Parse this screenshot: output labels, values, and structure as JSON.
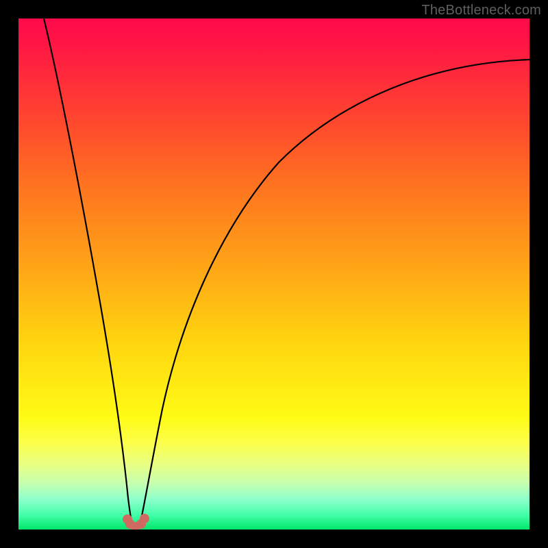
{
  "watermark": "TheBottleneck.com",
  "colors": {
    "frame": "#000000",
    "curve": "#000000",
    "marker_fill": "#cf6a61",
    "marker_stroke": "#cf6a61",
    "gradient_top": "#ff0a4b",
    "gradient_bottom": "#00e76a"
  },
  "chart_data": {
    "type": "line",
    "title": "",
    "xlabel": "",
    "ylabel": "",
    "xlim": [
      0,
      100
    ],
    "ylim": [
      0,
      100
    ],
    "grid": false,
    "legend": false,
    "series": [
      {
        "name": "left-branch",
        "x": [
          5,
          7,
          9,
          11,
          13,
          15,
          17,
          18.5,
          19.5,
          20.5,
          21,
          21.5,
          22
        ],
        "y": [
          100,
          85,
          70,
          56,
          43,
          31,
          20,
          12,
          7,
          3.5,
          2,
          1,
          0.6
        ]
      },
      {
        "name": "right-branch",
        "x": [
          24,
          25,
          26,
          28,
          31,
          35,
          40,
          46,
          53,
          61,
          70,
          80,
          90,
          100
        ],
        "y": [
          0.6,
          1.2,
          2.5,
          6,
          13,
          23,
          34,
          45,
          55,
          64,
          72,
          79,
          85,
          90
        ]
      }
    ],
    "markers": {
      "name": "minimum-marker",
      "shape": "u",
      "points": [
        {
          "x": 21.3,
          "y": 1.4
        },
        {
          "x": 22.0,
          "y": 0.7
        },
        {
          "x": 23.0,
          "y": 0.45
        },
        {
          "x": 24.0,
          "y": 0.7
        },
        {
          "x": 24.7,
          "y": 1.4
        }
      ]
    },
    "notch_x": 23,
    "annotations": []
  }
}
